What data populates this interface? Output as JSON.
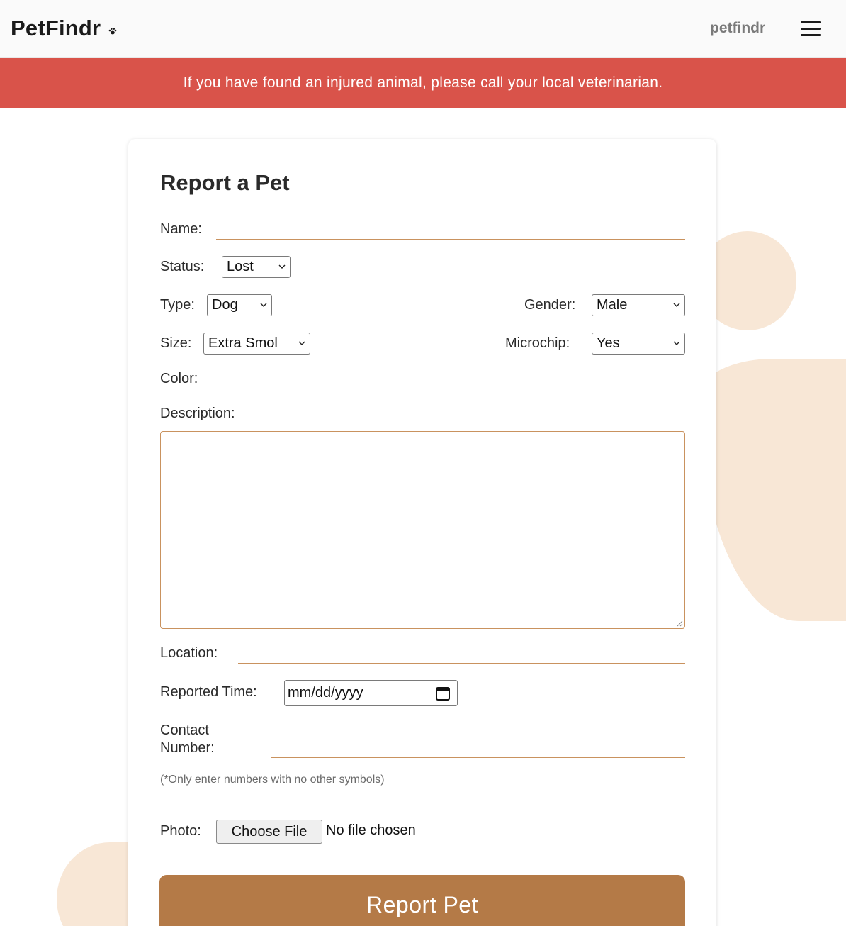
{
  "header": {
    "logo": "PetFindr",
    "nav_link": "petfindr"
  },
  "banner": {
    "text": "If you have found an injured animal, please call your local veterinarian."
  },
  "form": {
    "title": "Report a Pet",
    "name_label": "Name:",
    "name_value": "",
    "status_label": "Status:",
    "status_value": "Lost",
    "type_label": "Type:",
    "type_value": "Dog",
    "gender_label": "Gender:",
    "gender_value": "Male",
    "size_label": "Size:",
    "size_value": "Extra Smol",
    "microchip_label": "Microchip:",
    "microchip_value": "Yes",
    "color_label": "Color:",
    "color_value": "",
    "description_label": "Description:",
    "description_value": "",
    "location_label": "Location:",
    "location_value": "",
    "reported_time_label": "Reported Time:",
    "reported_time_placeholder": "mm/dd/yyyy",
    "contact_label_line1": "Contact",
    "contact_label_line2": "Number:",
    "contact_value": "",
    "contact_hint": "(*Only enter numbers with no other symbols)",
    "photo_label": "Photo:",
    "photo_button": "Choose File",
    "photo_status": "No file chosen",
    "submit_label": "Report Pet"
  },
  "colors": {
    "banner": "#d9534a",
    "accent": "#b47a47",
    "input_underline": "#c9925e",
    "blob": "#f8e7d6"
  },
  "icons": [
    "paw-icon",
    "hamburger-menu-icon",
    "chevron-down-icon",
    "calendar-icon",
    "resize-grip-icon"
  ]
}
